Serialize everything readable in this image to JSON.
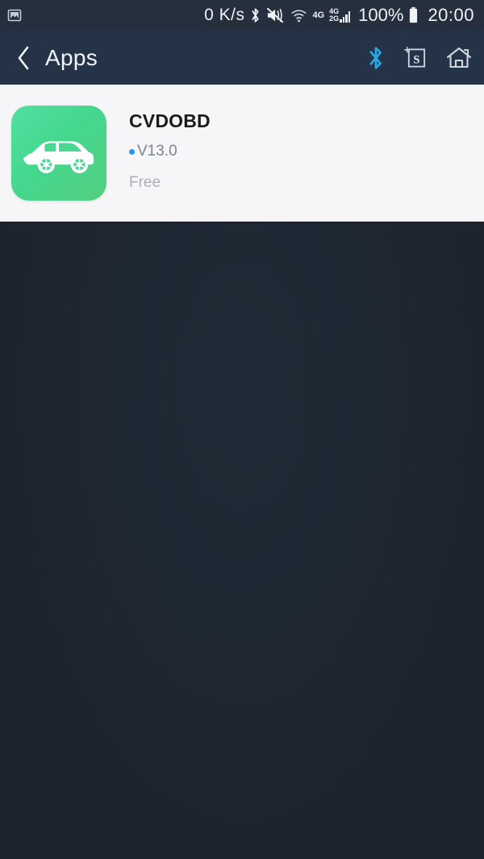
{
  "status_bar": {
    "screenshot_icon": "gallery-image-icon",
    "network_speed": "0 K/s",
    "bluetooth_icon": "bluetooth-icon",
    "mute_icon": "volume-muted-icon",
    "wifi_icon": "wifi-icon",
    "net_4g_label": "4G",
    "sim2_top_label": "4G",
    "sim2_bottom_label": "2G",
    "battery_percent": "100%",
    "battery_icon": "battery-full-icon",
    "time": "20:00"
  },
  "header": {
    "back_icon": "chevron-left-icon",
    "title": "Apps",
    "actions": [
      {
        "name": "bluetooth-icon",
        "color": "#27a9e3"
      },
      {
        "name": "screenshot-s-icon",
        "label": "S",
        "color": "#cfd6de"
      },
      {
        "name": "home-icon",
        "color": "#cfd6de"
      }
    ]
  },
  "app_list": {
    "items": [
      {
        "icon_name": "car-suv-icon",
        "icon_color": "#49d894",
        "name": "CVDOBD",
        "version": "V13.0",
        "version_dot_color": "#2196f3",
        "price": "Free"
      }
    ]
  },
  "colors": {
    "status_bar_bg": "#262f3d",
    "header_bg": "#253349",
    "body_bg": "#1e2833",
    "card_bg": "#f6f6f8",
    "accent_blue": "#27a9e3"
  }
}
